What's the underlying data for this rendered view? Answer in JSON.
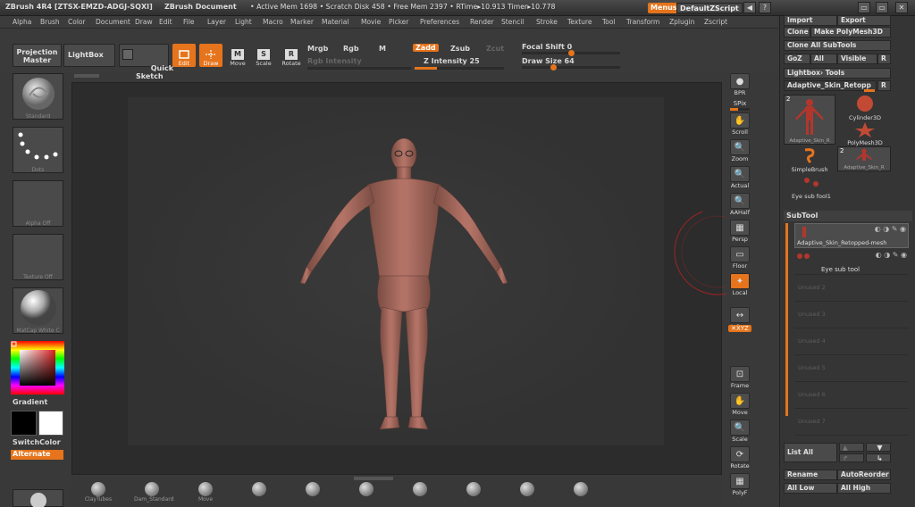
{
  "titlebar": {
    "app": "ZBrush 4R4 [ZTSX-EMZD-ADGJ-SQXI]",
    "doc": "ZBrush Document",
    "stats": "• Active Mem 1698 • Scratch Disk 458 • Free Mem 2397 • RTime▸10.913 Timer▸10.778",
    "menus_btn": "Menus",
    "script_btn": "DefaultZScript",
    "win_btns": [
      "◀",
      "?",
      "▭",
      "▭",
      "✕"
    ]
  },
  "menubar": [
    "Alpha",
    "Brush",
    "Color",
    "Document",
    "Draw",
    "Edit",
    "File",
    "Layer",
    "Light",
    "Macro",
    "Marker",
    "Material",
    "Movie",
    "Picker",
    "Preferences",
    "Render",
    "Stencil",
    "Stroke",
    "Texture",
    "Tool",
    "Transform",
    "Zplugin",
    "Zscript"
  ],
  "toolbar": {
    "projection_master": "Projection\nMaster",
    "lightbox": "LightBox",
    "quick_sketch": "Quick\nSketch",
    "edit": "Edit",
    "draw": "Draw",
    "move": "Move",
    "scale": "Scale",
    "rotate": "Rotate",
    "move_letter": "M",
    "scale_letter": "S",
    "rotate_letter": "R",
    "mrgb": "Mrgb",
    "rgb": "Rgb",
    "m": "M",
    "rgb_intensity": "Rgb Intensity",
    "zadd": "Zadd",
    "zsub": "Zsub",
    "zcut": "Zcut",
    "z_intensity_label": "Z Intensity 25",
    "z_intensity": 25,
    "focal_label": "Focal Shift 0",
    "focal": 0,
    "draw_size_label": "Draw Size 64",
    "draw_size": 64
  },
  "leftshelf": {
    "brush": "Standard",
    "stroke": "Dots",
    "alpha": "Alpha Off",
    "texture": "Texture Off",
    "material": "MatCap White C",
    "gradient": "Gradient",
    "switchcolor": "SwitchColor",
    "alternate": "Alternate"
  },
  "rightshelf": [
    {
      "name": "bpr",
      "label": "BPR",
      "icon": "●"
    },
    {
      "name": "spix",
      "label": "SPix",
      "icon": ""
    },
    {
      "name": "scroll",
      "label": "Scroll",
      "icon": "✋"
    },
    {
      "name": "zoom",
      "label": "Zoom",
      "icon": "🔍"
    },
    {
      "name": "actual",
      "label": "Actual",
      "icon": "🔍"
    },
    {
      "name": "aahalf",
      "label": "AAHalf",
      "icon": "🔍"
    },
    {
      "name": "persp",
      "label": "Persp",
      "icon": "▦"
    },
    {
      "name": "floor",
      "label": "Floor",
      "icon": "▭"
    },
    {
      "name": "local",
      "label": "Local",
      "icon": "✦"
    },
    {
      "name": "lsym",
      "label": "L.Sym",
      "icon": "↔"
    },
    {
      "name": "xyz",
      "label": "✕XYZ",
      "icon": ""
    },
    {
      "name": "frame",
      "label": "Frame",
      "icon": "⊡"
    },
    {
      "name": "move",
      "label": "Move",
      "icon": "✋"
    },
    {
      "name": "scale",
      "label": "Scale",
      "icon": "🔍"
    },
    {
      "name": "rotate",
      "label": "Rotate",
      "icon": "⟳"
    },
    {
      "name": "polyf",
      "label": "PolyF",
      "icon": "▦"
    }
  ],
  "toolpanel": {
    "import": "Import",
    "export": "Export",
    "clone": "Clone",
    "make_polymesh": "Make PolyMesh3D",
    "clone_all": "Clone All SubTools",
    "goz": "GoZ",
    "all": "All",
    "visible": "Visible",
    "r": "R",
    "lightbox_tools": "Lightbox› Tools",
    "current_tool": "Adaptive_Skin_Retopp",
    "tools": [
      {
        "name": "Adaptive_Skin_R",
        "count": "2"
      },
      {
        "name": "Cylinder3D",
        "count": ""
      },
      {
        "name": "PolyMesh3D",
        "count": ""
      },
      {
        "name": "SimpleBrush",
        "count": ""
      },
      {
        "name": "Adaptive_Skin_R",
        "count": "2"
      },
      {
        "name": "Eye sub fool1",
        "count": ""
      }
    ]
  },
  "subtool": {
    "title": "SubTool",
    "items": [
      {
        "name": "Adaptive_Skin_Retopped-mesh",
        "active": true
      },
      {
        "name": "Eye sub tool",
        "active": false
      },
      {
        "name": "Unused 2",
        "active": false
      },
      {
        "name": "Unused 3",
        "active": false
      },
      {
        "name": "Unused 4",
        "active": false
      },
      {
        "name": "Unused 5",
        "active": false
      },
      {
        "name": "Unused 6",
        "active": false
      },
      {
        "name": "Unused 7",
        "active": false
      }
    ],
    "list_all": "List All",
    "rename": "Rename",
    "autoreorder": "AutoReorder",
    "all_low": "All Low",
    "all_high": "All High"
  },
  "bottom_brushes": [
    "ClayTubes",
    "Dam_Standard",
    "Move",
    "",
    "",
    "",
    "",
    "",
    "",
    ""
  ],
  "colors": {
    "accent": "#e5741c",
    "skin": "#a86a5c"
  }
}
